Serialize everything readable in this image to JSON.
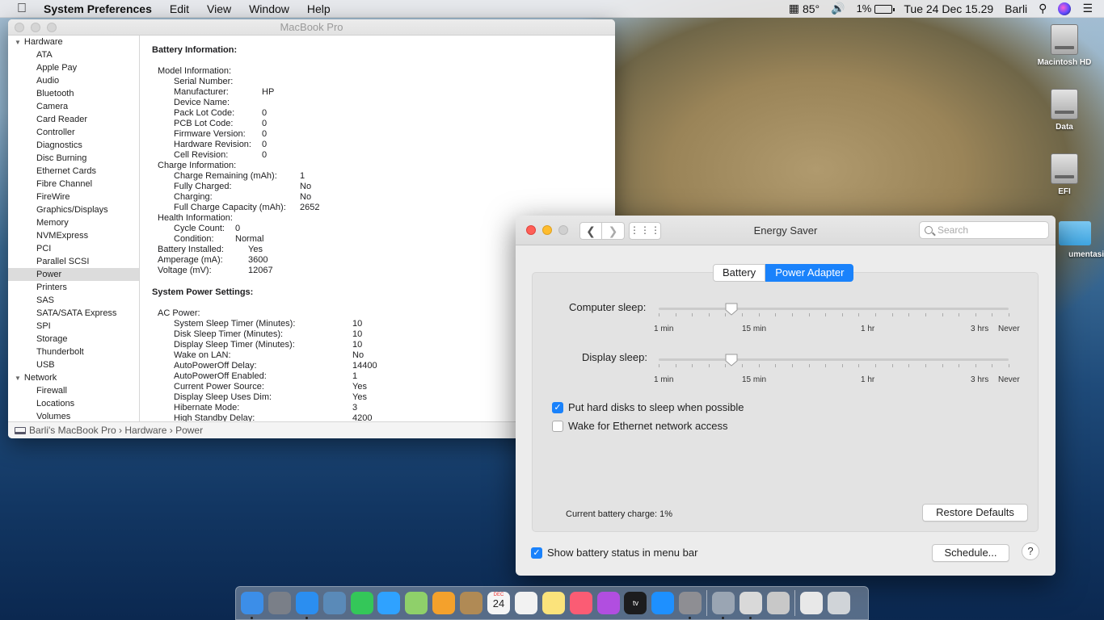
{
  "menubar": {
    "app": "System Preferences",
    "menus": [
      "Edit",
      "View",
      "Window",
      "Help"
    ],
    "temp": "85°",
    "battery_pct": "1%",
    "datetime": "Tue 24 Dec  15.29",
    "user": "Barli"
  },
  "desktop": {
    "icons": [
      "Macintosh HD",
      "Data",
      "EFI",
      "umentasi"
    ]
  },
  "info_window": {
    "title": "MacBook Pro",
    "sidebar": {
      "hardware_label": "Hardware",
      "hardware_items": [
        "ATA",
        "Apple Pay",
        "Audio",
        "Bluetooth",
        "Camera",
        "Card Reader",
        "Controller",
        "Diagnostics",
        "Disc Burning",
        "Ethernet Cards",
        "Fibre Channel",
        "FireWire",
        "Graphics/Displays",
        "Memory",
        "NVMExpress",
        "PCI",
        "Parallel SCSI",
        "Power",
        "Printers",
        "SAS",
        "SATA/SATA Express",
        "SPI",
        "Storage",
        "Thunderbolt",
        "USB"
      ],
      "selected": "Power",
      "network_label": "Network",
      "network_items": [
        "Firewall",
        "Locations",
        "Volumes"
      ]
    },
    "battery_heading": "Battery Information:",
    "battery_rows": [
      {
        "k": "Model Information:",
        "v": "",
        "lvl": 1,
        "w": 120
      },
      {
        "k": "Serial Number:",
        "v": "",
        "lvl": 2,
        "w": 109
      },
      {
        "k": "Manufacturer:",
        "v": "HP",
        "lvl": 2,
        "w": 109
      },
      {
        "k": "Device Name:",
        "v": "",
        "lvl": 2,
        "w": 109
      },
      {
        "k": "Pack Lot Code:",
        "v": "0",
        "lvl": 2,
        "w": 109
      },
      {
        "k": "PCB Lot Code:",
        "v": "0",
        "lvl": 2,
        "w": 109
      },
      {
        "k": "Firmware Version:",
        "v": "0",
        "lvl": 2,
        "w": 109
      },
      {
        "k": "Hardware Revision:",
        "v": "0",
        "lvl": 2,
        "w": 109
      },
      {
        "k": "Cell Revision:",
        "v": "0",
        "lvl": 2,
        "w": 109
      },
      {
        "k": "Charge Information:",
        "v": "",
        "lvl": 1,
        "w": 120
      },
      {
        "k": "Charge Remaining (mAh):",
        "v": "1",
        "lvl": 2,
        "w": 156
      },
      {
        "k": "Fully Charged:",
        "v": "No",
        "lvl": 2,
        "w": 156
      },
      {
        "k": "Charging:",
        "v": "No",
        "lvl": 2,
        "w": 156
      },
      {
        "k": "Full Charge Capacity (mAh):",
        "v": "2652",
        "lvl": 2,
        "w": 156
      },
      {
        "k": "Health Information:",
        "v": "",
        "lvl": 1,
        "w": 120
      },
      {
        "k": "Cycle Count:",
        "v": "0",
        "lvl": 2,
        "w": 76
      },
      {
        "k": "Condition:",
        "v": "Normal",
        "lvl": 2,
        "w": 76
      },
      {
        "k": "Battery Installed:",
        "v": "Yes",
        "lvl": 1,
        "w": 112
      },
      {
        "k": "Amperage (mA):",
        "v": "3600",
        "lvl": 1,
        "w": 112
      },
      {
        "k": "Voltage (mV):",
        "v": "12067",
        "lvl": 1,
        "w": 112
      }
    ],
    "power_heading": "System Power Settings:",
    "power_rows": [
      {
        "k": "AC Power:",
        "v": "",
        "lvl": 1,
        "w": 120
      },
      {
        "k": "System Sleep Timer (Minutes):",
        "v": "10",
        "lvl": 2,
        "w": 221
      },
      {
        "k": "Disk Sleep Timer (Minutes):",
        "v": "10",
        "lvl": 2,
        "w": 221
      },
      {
        "k": "Display Sleep Timer (Minutes):",
        "v": "10",
        "lvl": 2,
        "w": 221
      },
      {
        "k": "Wake on LAN:",
        "v": "No",
        "lvl": 2,
        "w": 221
      },
      {
        "k": "AutoPowerOff Delay:",
        "v": "14400",
        "lvl": 2,
        "w": 221
      },
      {
        "k": "AutoPowerOff Enabled:",
        "v": "1",
        "lvl": 2,
        "w": 221
      },
      {
        "k": "Current Power Source:",
        "v": "Yes",
        "lvl": 2,
        "w": 221
      },
      {
        "k": "Display Sleep Uses Dim:",
        "v": "Yes",
        "lvl": 2,
        "w": 221
      },
      {
        "k": "Hibernate Mode:",
        "v": "3",
        "lvl": 2,
        "w": 221
      },
      {
        "k": "High Standby Delay:",
        "v": "4200",
        "lvl": 2,
        "w": 221
      }
    ],
    "breadcrumb": [
      "Barli's MacBook Pro",
      "Hardware",
      "Power"
    ]
  },
  "energy_saver": {
    "title": "Energy Saver",
    "search_placeholder": "Search",
    "tabs": [
      "Battery",
      "Power Adapter"
    ],
    "active_tab": "Power Adapter",
    "computer_sleep_label": "Computer sleep:",
    "display_sleep_label": "Display sleep:",
    "computer_sleep_value_minutes": 10,
    "display_sleep_value_minutes": 10,
    "tick_labels": [
      "1 min",
      "15 min",
      "1 hr",
      "3 hrs",
      "Never"
    ],
    "hard_disks_label": "Put hard disks to sleep when possible",
    "hard_disks_checked": true,
    "wake_ethernet_label": "Wake for Ethernet network access",
    "wake_ethernet_checked": false,
    "battery_charge_label": "Current battery charge: 1%",
    "restore_defaults": "Restore Defaults",
    "show_battery_label": "Show battery status in menu bar",
    "show_battery_checked": true,
    "schedule": "Schedule...",
    "help": "?",
    "accent": "#1a82fb"
  },
  "dock": {
    "apps": [
      {
        "name": "finder",
        "color": "#3c8ee8",
        "running": true
      },
      {
        "name": "launchpad",
        "color": "#7a7f88",
        "running": false
      },
      {
        "name": "safari",
        "color": "#2b8ef0",
        "running": true
      },
      {
        "name": "preview",
        "color": "#5a8ab8",
        "running": false
      },
      {
        "name": "facetime",
        "color": "#34c759",
        "running": false
      },
      {
        "name": "messages",
        "color": "#2fa2ff",
        "running": false
      },
      {
        "name": "maps",
        "color": "#8fd06a",
        "running": false
      },
      {
        "name": "photos",
        "color": "#f4a12c",
        "running": false
      },
      {
        "name": "contacts",
        "color": "#b08a55",
        "running": false
      },
      {
        "name": "calendar",
        "color": "#f5f5f5",
        "running": false
      },
      {
        "name": "reminders",
        "color": "#f2f2f2",
        "running": false
      },
      {
        "name": "notes",
        "color": "#fbe37b",
        "running": false
      },
      {
        "name": "music",
        "color": "#fb5c74",
        "running": false
      },
      {
        "name": "podcasts",
        "color": "#b14ee0",
        "running": false
      },
      {
        "name": "tv",
        "color": "#1c1c1e",
        "running": false
      },
      {
        "name": "app-store",
        "color": "#1e90ff",
        "running": false
      },
      {
        "name": "system-preferences",
        "color": "#8e8e93",
        "running": true
      }
    ],
    "apps2": [
      {
        "name": "utilities",
        "color": "#9aa5b3",
        "running": true
      },
      {
        "name": "script-editor",
        "color": "#d9d9d9",
        "running": true
      },
      {
        "name": "kext-utility",
        "color": "#c8c8c8",
        "running": false
      }
    ],
    "apps3": [
      {
        "name": "documents",
        "color": "#e8e8e8",
        "running": false
      },
      {
        "name": "trash",
        "color": "#d0d4d8",
        "running": false
      }
    ],
    "calendar_day": "24",
    "calendar_month": "DEC"
  }
}
